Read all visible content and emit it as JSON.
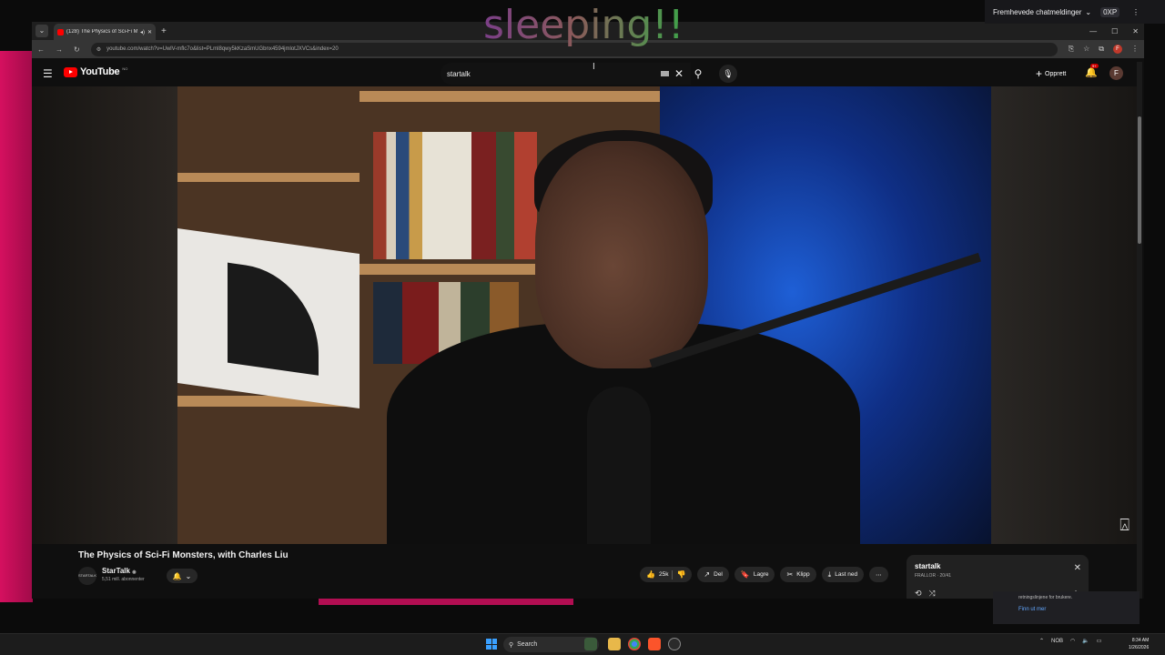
{
  "overlay": {
    "text": "sleeping!!"
  },
  "stream_bar": {
    "label": "Fremhevede chatmeldinger",
    "chevron": "⌄",
    "badge": "0XP",
    "more": "⋮"
  },
  "browser": {
    "tab_title": "(128) The Physics of Sci-Fi M",
    "tab_audio": "◂)",
    "tab_close": "✕",
    "new_tab": "+",
    "tab_list": "⌄",
    "min": "—",
    "max": "☐",
    "close": "✕",
    "back": "←",
    "forward": "→",
    "reload": "↻",
    "url": "youtube.com/watch?v=UwlV-mflc7o&list=PLml8qwy5kKzaSmUGbnx4594jmlotJXVCs&index=20",
    "profile_letter": "F",
    "menu": "⋮"
  },
  "youtube": {
    "menu_icon": "☰",
    "logo_text": "YouTube",
    "region": "NO",
    "search_value": "startalk",
    "search_clear": "✕",
    "search_icon": "⚲",
    "mic_icon": "🎙",
    "create_label": "Opprett",
    "create_plus": "+",
    "bell_icon": "🔔",
    "notif_count": "9+",
    "avatar_letter": "F"
  },
  "video": {
    "title": "The Physics of Sci-Fi Monsters, with Charles Liu",
    "watermark": "⍓",
    "channel": {
      "avatar_text": "STARTALK",
      "name": "StarTalk",
      "verified": "◉",
      "subs": "5,51 mill. abonnenter",
      "bell": "🔔",
      "chevron": "⌄"
    },
    "actions": {
      "like_icon": "👍",
      "likes": "25k",
      "dislike_icon": "👎",
      "share_icon": "↗",
      "share": "Del",
      "save_icon": "🔖",
      "save": "Lagre",
      "clip_icon": "✂",
      "clip": "Klipp",
      "download_icon": "⤓",
      "download": "Last ned",
      "more": "⋯"
    }
  },
  "playlist": {
    "title": "startalk",
    "subtitle": "FRALLOR · 20/41",
    "close": "✕",
    "loop_icon": "⟲",
    "shuffle_icon": "⤨",
    "more": "⋮"
  },
  "notification": {
    "text": "retningslinjene for brukere.",
    "link": "Finn ut mer"
  },
  "taskbar": {
    "search_label": "Search",
    "search_icon": "⚲",
    "tray_chevron": "⌃",
    "lang": "NOB",
    "wifi": "◠",
    "speaker": "🔈",
    "battery": "▭",
    "time": "8:34 AM",
    "date": "1/26/2026"
  },
  "colors": {
    "accent_red": "#ff0000",
    "link_blue": "#63a7ff",
    "pink": "#d5105f"
  }
}
